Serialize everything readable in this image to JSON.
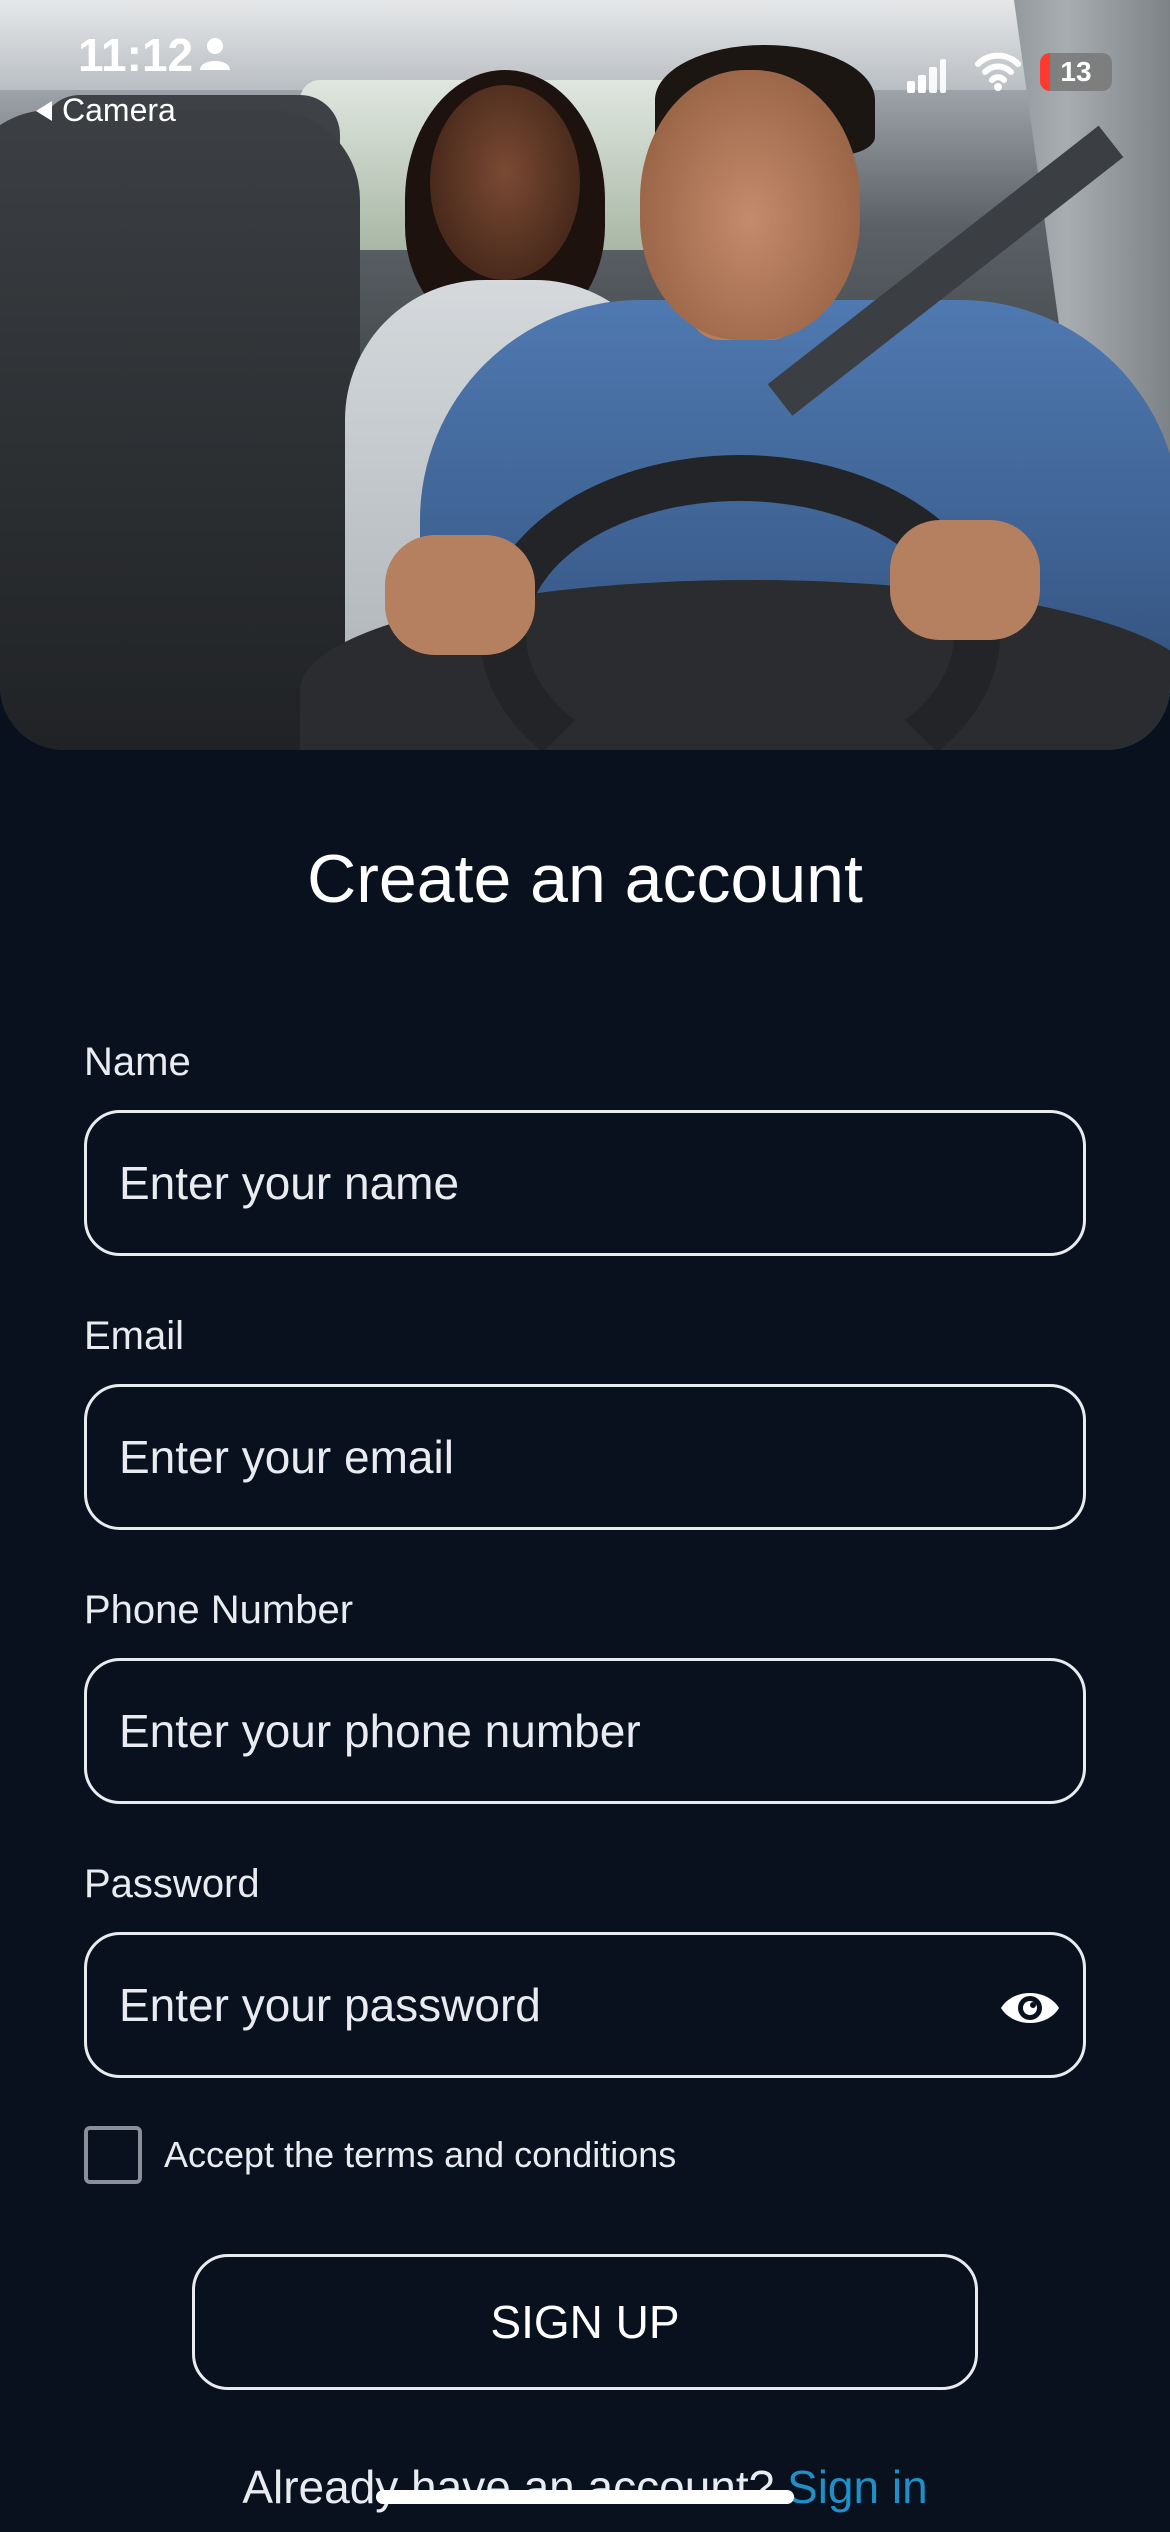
{
  "status_bar": {
    "time": "11:12",
    "back_label": "Camera",
    "battery": "13"
  },
  "hero": {
    "image": "driver-and-passenger-in-car-photo"
  },
  "form": {
    "title": "Create an account",
    "name": {
      "label": "Name",
      "placeholder": "Enter your name"
    },
    "email": {
      "label": "Email",
      "placeholder": "Enter your email"
    },
    "phone": {
      "label": "Phone Number",
      "placeholder": "Enter your phone number"
    },
    "password": {
      "label": "Password",
      "placeholder": "Enter your password"
    },
    "terms_label": "Accept the terms and conditions",
    "terms_checked": false,
    "submit_label": "SIGN UP"
  },
  "footer": {
    "prompt": "Already have an account?",
    "link": "Sign in"
  },
  "colors": {
    "background": "#08111d",
    "text": "#ffffff",
    "link": "#1e8fc7",
    "battery_low": "#ff3b30"
  }
}
